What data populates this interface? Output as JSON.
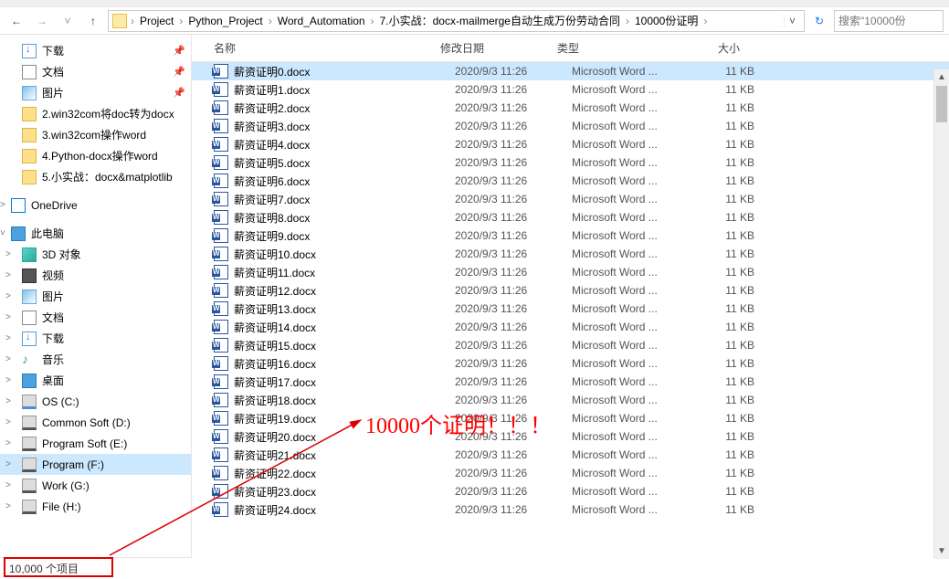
{
  "breadcrumb": {
    "segments": [
      "Project",
      "Python_Project",
      "Word_Automation",
      "7.小实战：docx-mailmerge自动生成万份劳动合同",
      "10000份证明"
    ]
  },
  "search": {
    "placeholder": "搜索\"10000份"
  },
  "sidebar": {
    "quick": [
      {
        "label": "下载",
        "icon": "downloads",
        "pin": true
      },
      {
        "label": "文档",
        "icon": "documents",
        "pin": true
      },
      {
        "label": "图片",
        "icon": "pictures",
        "pin": true
      },
      {
        "label": "2.win32com将doc转为docx",
        "icon": "folder"
      },
      {
        "label": "3.win32com操作word",
        "icon": "folder"
      },
      {
        "label": "4.Python-docx操作word",
        "icon": "folder"
      },
      {
        "label": "5.小实战：docx&matplotlib",
        "icon": "folder"
      }
    ],
    "onedrive": {
      "label": "OneDrive"
    },
    "thispc": {
      "label": "此电脑"
    },
    "pcitems": [
      {
        "label": "3D 对象",
        "icon": "obj3d"
      },
      {
        "label": "视频",
        "icon": "video"
      },
      {
        "label": "图片",
        "icon": "pictures"
      },
      {
        "label": "文档",
        "icon": "documents"
      },
      {
        "label": "下载",
        "icon": "downloads"
      },
      {
        "label": "音乐",
        "icon": "music"
      },
      {
        "label": "桌面",
        "icon": "desktop"
      },
      {
        "label": "OS (C:)",
        "icon": "drive"
      },
      {
        "label": "Common Soft (D:)",
        "icon": "drive dark"
      },
      {
        "label": "Program Soft (E:)",
        "icon": "drive dark"
      },
      {
        "label": "Program (F:)",
        "icon": "drive dark",
        "selected": true
      },
      {
        "label": "Work (G:)",
        "icon": "drive dark"
      },
      {
        "label": "File (H:)",
        "icon": "drive dark"
      }
    ]
  },
  "columns": {
    "name": "名称",
    "date": "修改日期",
    "type": "类型",
    "size": "大小"
  },
  "files": [
    {
      "name": "薪资证明0.docx",
      "date": "2020/9/3 11:26",
      "type": "Microsoft Word ...",
      "size": "11 KB",
      "selected": true
    },
    {
      "name": "薪资证明1.docx",
      "date": "2020/9/3 11:26",
      "type": "Microsoft Word ...",
      "size": "11 KB"
    },
    {
      "name": "薪资证明2.docx",
      "date": "2020/9/3 11:26",
      "type": "Microsoft Word ...",
      "size": "11 KB"
    },
    {
      "name": "薪资证明3.docx",
      "date": "2020/9/3 11:26",
      "type": "Microsoft Word ...",
      "size": "11 KB"
    },
    {
      "name": "薪资证明4.docx",
      "date": "2020/9/3 11:26",
      "type": "Microsoft Word ...",
      "size": "11 KB"
    },
    {
      "name": "薪资证明5.docx",
      "date": "2020/9/3 11:26",
      "type": "Microsoft Word ...",
      "size": "11 KB"
    },
    {
      "name": "薪资证明6.docx",
      "date": "2020/9/3 11:26",
      "type": "Microsoft Word ...",
      "size": "11 KB"
    },
    {
      "name": "薪资证明7.docx",
      "date": "2020/9/3 11:26",
      "type": "Microsoft Word ...",
      "size": "11 KB"
    },
    {
      "name": "薪资证明8.docx",
      "date": "2020/9/3 11:26",
      "type": "Microsoft Word ...",
      "size": "11 KB"
    },
    {
      "name": "薪资证明9.docx",
      "date": "2020/9/3 11:26",
      "type": "Microsoft Word ...",
      "size": "11 KB"
    },
    {
      "name": "薪资证明10.docx",
      "date": "2020/9/3 11:26",
      "type": "Microsoft Word ...",
      "size": "11 KB"
    },
    {
      "name": "薪资证明11.docx",
      "date": "2020/9/3 11:26",
      "type": "Microsoft Word ...",
      "size": "11 KB"
    },
    {
      "name": "薪资证明12.docx",
      "date": "2020/9/3 11:26",
      "type": "Microsoft Word ...",
      "size": "11 KB"
    },
    {
      "name": "薪资证明13.docx",
      "date": "2020/9/3 11:26",
      "type": "Microsoft Word ...",
      "size": "11 KB"
    },
    {
      "name": "薪资证明14.docx",
      "date": "2020/9/3 11:26",
      "type": "Microsoft Word ...",
      "size": "11 KB"
    },
    {
      "name": "薪资证明15.docx",
      "date": "2020/9/3 11:26",
      "type": "Microsoft Word ...",
      "size": "11 KB"
    },
    {
      "name": "薪资证明16.docx",
      "date": "2020/9/3 11:26",
      "type": "Microsoft Word ...",
      "size": "11 KB"
    },
    {
      "name": "薪资证明17.docx",
      "date": "2020/9/3 11:26",
      "type": "Microsoft Word ...",
      "size": "11 KB"
    },
    {
      "name": "薪资证明18.docx",
      "date": "2020/9/3 11:26",
      "type": "Microsoft Word ...",
      "size": "11 KB"
    },
    {
      "name": "薪资证明19.docx",
      "date": "2020/9/3 11:26",
      "type": "Microsoft Word ...",
      "size": "11 KB"
    },
    {
      "name": "薪资证明20.docx",
      "date": "2020/9/3 11:26",
      "type": "Microsoft Word ...",
      "size": "11 KB"
    },
    {
      "name": "薪资证明21.docx",
      "date": "2020/9/3 11:26",
      "type": "Microsoft Word ...",
      "size": "11 KB"
    },
    {
      "name": "薪资证明22.docx",
      "date": "2020/9/3 11:26",
      "type": "Microsoft Word ...",
      "size": "11 KB"
    },
    {
      "name": "薪资证明23.docx",
      "date": "2020/9/3 11:26",
      "type": "Microsoft Word ...",
      "size": "11 KB"
    },
    {
      "name": "薪资证明24.docx",
      "date": "2020/9/3 11:26",
      "type": "Microsoft Word ...",
      "size": "11 KB"
    }
  ],
  "status": {
    "count_text": "10,000 个项目"
  },
  "annotation": {
    "text": "10000个证明！！！"
  }
}
